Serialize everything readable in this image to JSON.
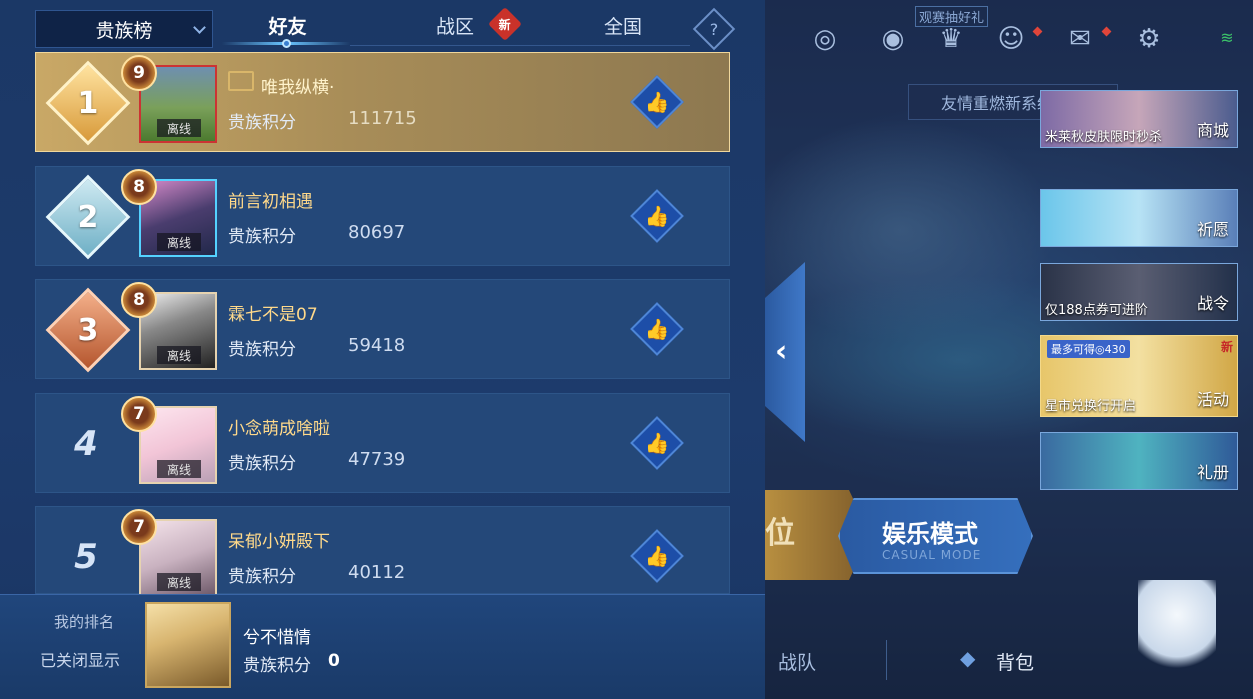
{
  "tabs": {
    "dropdown_label": "贵族榜",
    "friends": "好友",
    "zone": "战区",
    "zone_badge": "新",
    "national": "全国",
    "help": "?"
  },
  "rows": [
    {
      "rank": "1",
      "level": "9",
      "name": "唯我纵横·",
      "score_label": "贵族积分",
      "score": "111715",
      "status": "离线"
    },
    {
      "rank": "2",
      "level": "8",
      "name": "前言初相遇",
      "score_label": "贵族积分",
      "score": "80697",
      "status": "离线"
    },
    {
      "rank": "3",
      "level": "8",
      "name": "霖七不是07",
      "score_label": "贵族积分",
      "score": "59418",
      "status": "离线"
    },
    {
      "rank": "4",
      "level": "7",
      "name": "小念萌成啥啦",
      "score_label": "贵族积分",
      "score": "47739",
      "status": "离线"
    },
    {
      "rank": "5",
      "level": "7",
      "name": "呆郁小妍殿下",
      "score_label": "贵族积分",
      "score": "40112",
      "status": "离线"
    }
  ],
  "my_rank": {
    "title": "我的排名",
    "status": "已关闭显示",
    "name": "兮不惜情",
    "score_label": "贵族积分",
    "score": "0"
  },
  "hud": {
    "spectate": "观赛抽好礼",
    "friend_banner": "友情重燃新系统上线",
    "cards": [
      {
        "label": "米莱秋皮肤限时秒杀",
        "tag": "商城"
      },
      {
        "label": "",
        "tag": "祈愿"
      },
      {
        "label": "仅188点券可进阶",
        "tag": "战令"
      },
      {
        "label": "星市兑换行开启",
        "tag": "活动",
        "promo": "最多可得◎430",
        "badge": "新"
      },
      {
        "label": "",
        "tag": "礼册"
      }
    ],
    "mode_rank": "位",
    "mode_casual": "娱乐模式",
    "mode_casual_en": "CASUAL MODE",
    "nav_team": "战队",
    "nav_bag": "背包"
  },
  "colors": {
    "panel_bg": "#1d3b6c",
    "first_row_gold": "#c9a866",
    "name_gold": "#ffd98a",
    "like_blue": "#1d4ea8"
  }
}
